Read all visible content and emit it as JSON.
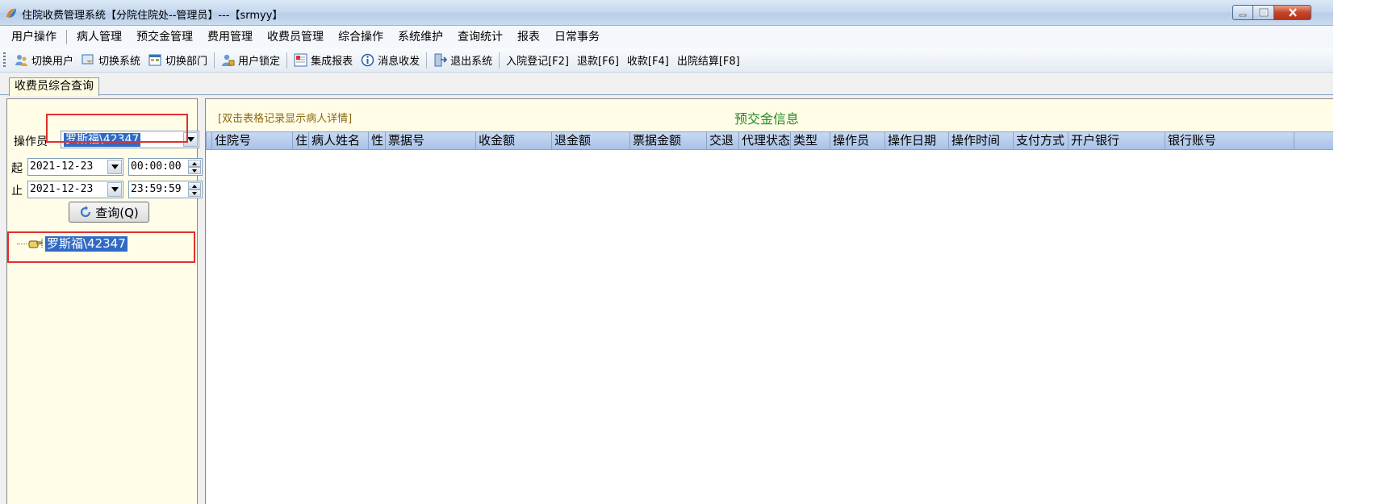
{
  "window": {
    "title": "住院收费管理系统【分院住院处--管理员】---【srmyy】",
    "controls": [
      "minimize",
      "maximize",
      "close"
    ]
  },
  "menu": [
    "用户操作",
    "病人管理",
    "预交金管理",
    "费用管理",
    "收费员管理",
    "综合操作",
    "系统维护",
    "查询统计",
    "报表",
    "日常事务"
  ],
  "toolbar": {
    "switch_user": "切换用户",
    "switch_system": "切换系统",
    "switch_dept": "切换部门",
    "lock_user": "用户锁定",
    "integrated_report": "集成报表",
    "messages": "消息收发",
    "exit_system": "退出系统",
    "admission": "入院登记[F2]",
    "refund": "退款[F6]",
    "collect": "收款[F4]",
    "discharge": "出院结算[F8]"
  },
  "tab": {
    "label": "收费员综合查询"
  },
  "left": {
    "operator_label": "操作员",
    "operator_value": "罗斯福\\42347",
    "start_label": "起",
    "end_label": "止",
    "start_date": "2021-12-23",
    "start_time": "00:00:00",
    "end_date": "2021-12-23",
    "end_time": "23:59:59",
    "query_button": "查询(Q)",
    "tree_node": "罗斯福\\42347"
  },
  "right": {
    "hint": "[双击表格记录显示病人详情]",
    "section_title": "预交金信息",
    "columns": [
      "住院号",
      "住",
      "病人姓名",
      "性",
      "票据号",
      "收金额",
      "退金额",
      "票据金额",
      "交退",
      "代理状态",
      "类型",
      "操作员",
      "操作日期",
      "操作时间",
      "支付方式",
      "开户银行",
      "银行账号"
    ]
  },
  "colors": {
    "selection": "#316ac5",
    "highlight_box": "#e03030",
    "section_title": "#228b22",
    "hint_text": "#8b6914",
    "panel_bg": "#fffde7"
  }
}
